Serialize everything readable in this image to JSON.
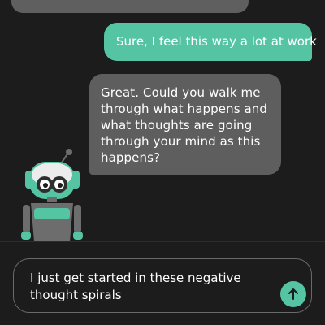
{
  "chat": {
    "messages": [
      {
        "sender": "bot",
        "text": ""
      },
      {
        "sender": "user",
        "text": "Sure, I feel this way a lot at work"
      },
      {
        "sender": "bot",
        "text": "Great. Could you walk me through what happens and what thoughts are going through your mind as this happens?"
      }
    ]
  },
  "composer": {
    "value": "I just get started in these negative thought spirals"
  },
  "icons": {
    "send": "arrow-up-icon",
    "avatar": "robot-avatar-icon"
  },
  "colors": {
    "background": "#1c1c1c",
    "accent": "#55c4a3",
    "bot_bubble": "#5e5e5e",
    "text": "#ffffff"
  }
}
